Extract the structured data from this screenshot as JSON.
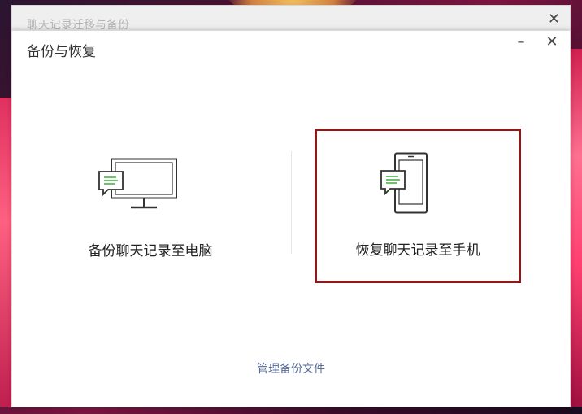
{
  "back_window": {
    "title": "聊天记录迁移与备份"
  },
  "dialog": {
    "title": "备份与恢复",
    "minimize_glyph": "–",
    "close_glyph": "✕"
  },
  "options": [
    {
      "label": "备份聊天记录至电脑",
      "icon": "monitor-chat-icon",
      "selected": false
    },
    {
      "label": "恢复聊天记录至手机",
      "icon": "phone-chat-icon",
      "selected": true
    }
  ],
  "manage_link": "管理备份文件",
  "colors": {
    "selection_border": "#8b1a1a",
    "chat_green": "#3fae3a",
    "link": "#576b95"
  }
}
